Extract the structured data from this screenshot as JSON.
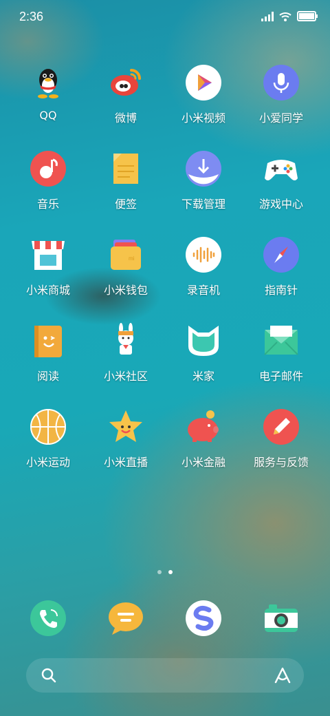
{
  "status_bar": {
    "time": "2:36"
  },
  "apps": [
    {
      "id": "qq",
      "label": "QQ"
    },
    {
      "id": "weibo",
      "label": "微博"
    },
    {
      "id": "mi-video",
      "label": "小米视频"
    },
    {
      "id": "xiaoai",
      "label": "小爱同学"
    },
    {
      "id": "music",
      "label": "音乐"
    },
    {
      "id": "notes",
      "label": "便签"
    },
    {
      "id": "downloads",
      "label": "下载管理"
    },
    {
      "id": "game-center",
      "label": "游戏中心"
    },
    {
      "id": "mi-store",
      "label": "小米商城"
    },
    {
      "id": "mi-wallet",
      "label": "小米钱包"
    },
    {
      "id": "recorder",
      "label": "录音机"
    },
    {
      "id": "compass",
      "label": "指南针"
    },
    {
      "id": "reader",
      "label": "阅读"
    },
    {
      "id": "mi-community",
      "label": "小米社区"
    },
    {
      "id": "mi-home",
      "label": "米家"
    },
    {
      "id": "email",
      "label": "电子邮件"
    },
    {
      "id": "mi-sports",
      "label": "小米运动"
    },
    {
      "id": "mi-live",
      "label": "小米直播"
    },
    {
      "id": "mi-finance",
      "label": "小米金融"
    },
    {
      "id": "feedback",
      "label": "服务与反馈"
    }
  ],
  "dock": [
    {
      "id": "phone",
      "icon": "phone-icon"
    },
    {
      "id": "messages",
      "icon": "messages-icon"
    },
    {
      "id": "browser",
      "icon": "browser-icon"
    },
    {
      "id": "camera",
      "icon": "camera-icon"
    }
  ],
  "page_indicator": {
    "pages": 2,
    "current": 2
  },
  "search": {
    "left_icon": "search-icon",
    "right_icon": "xiaoai-logo-icon"
  }
}
